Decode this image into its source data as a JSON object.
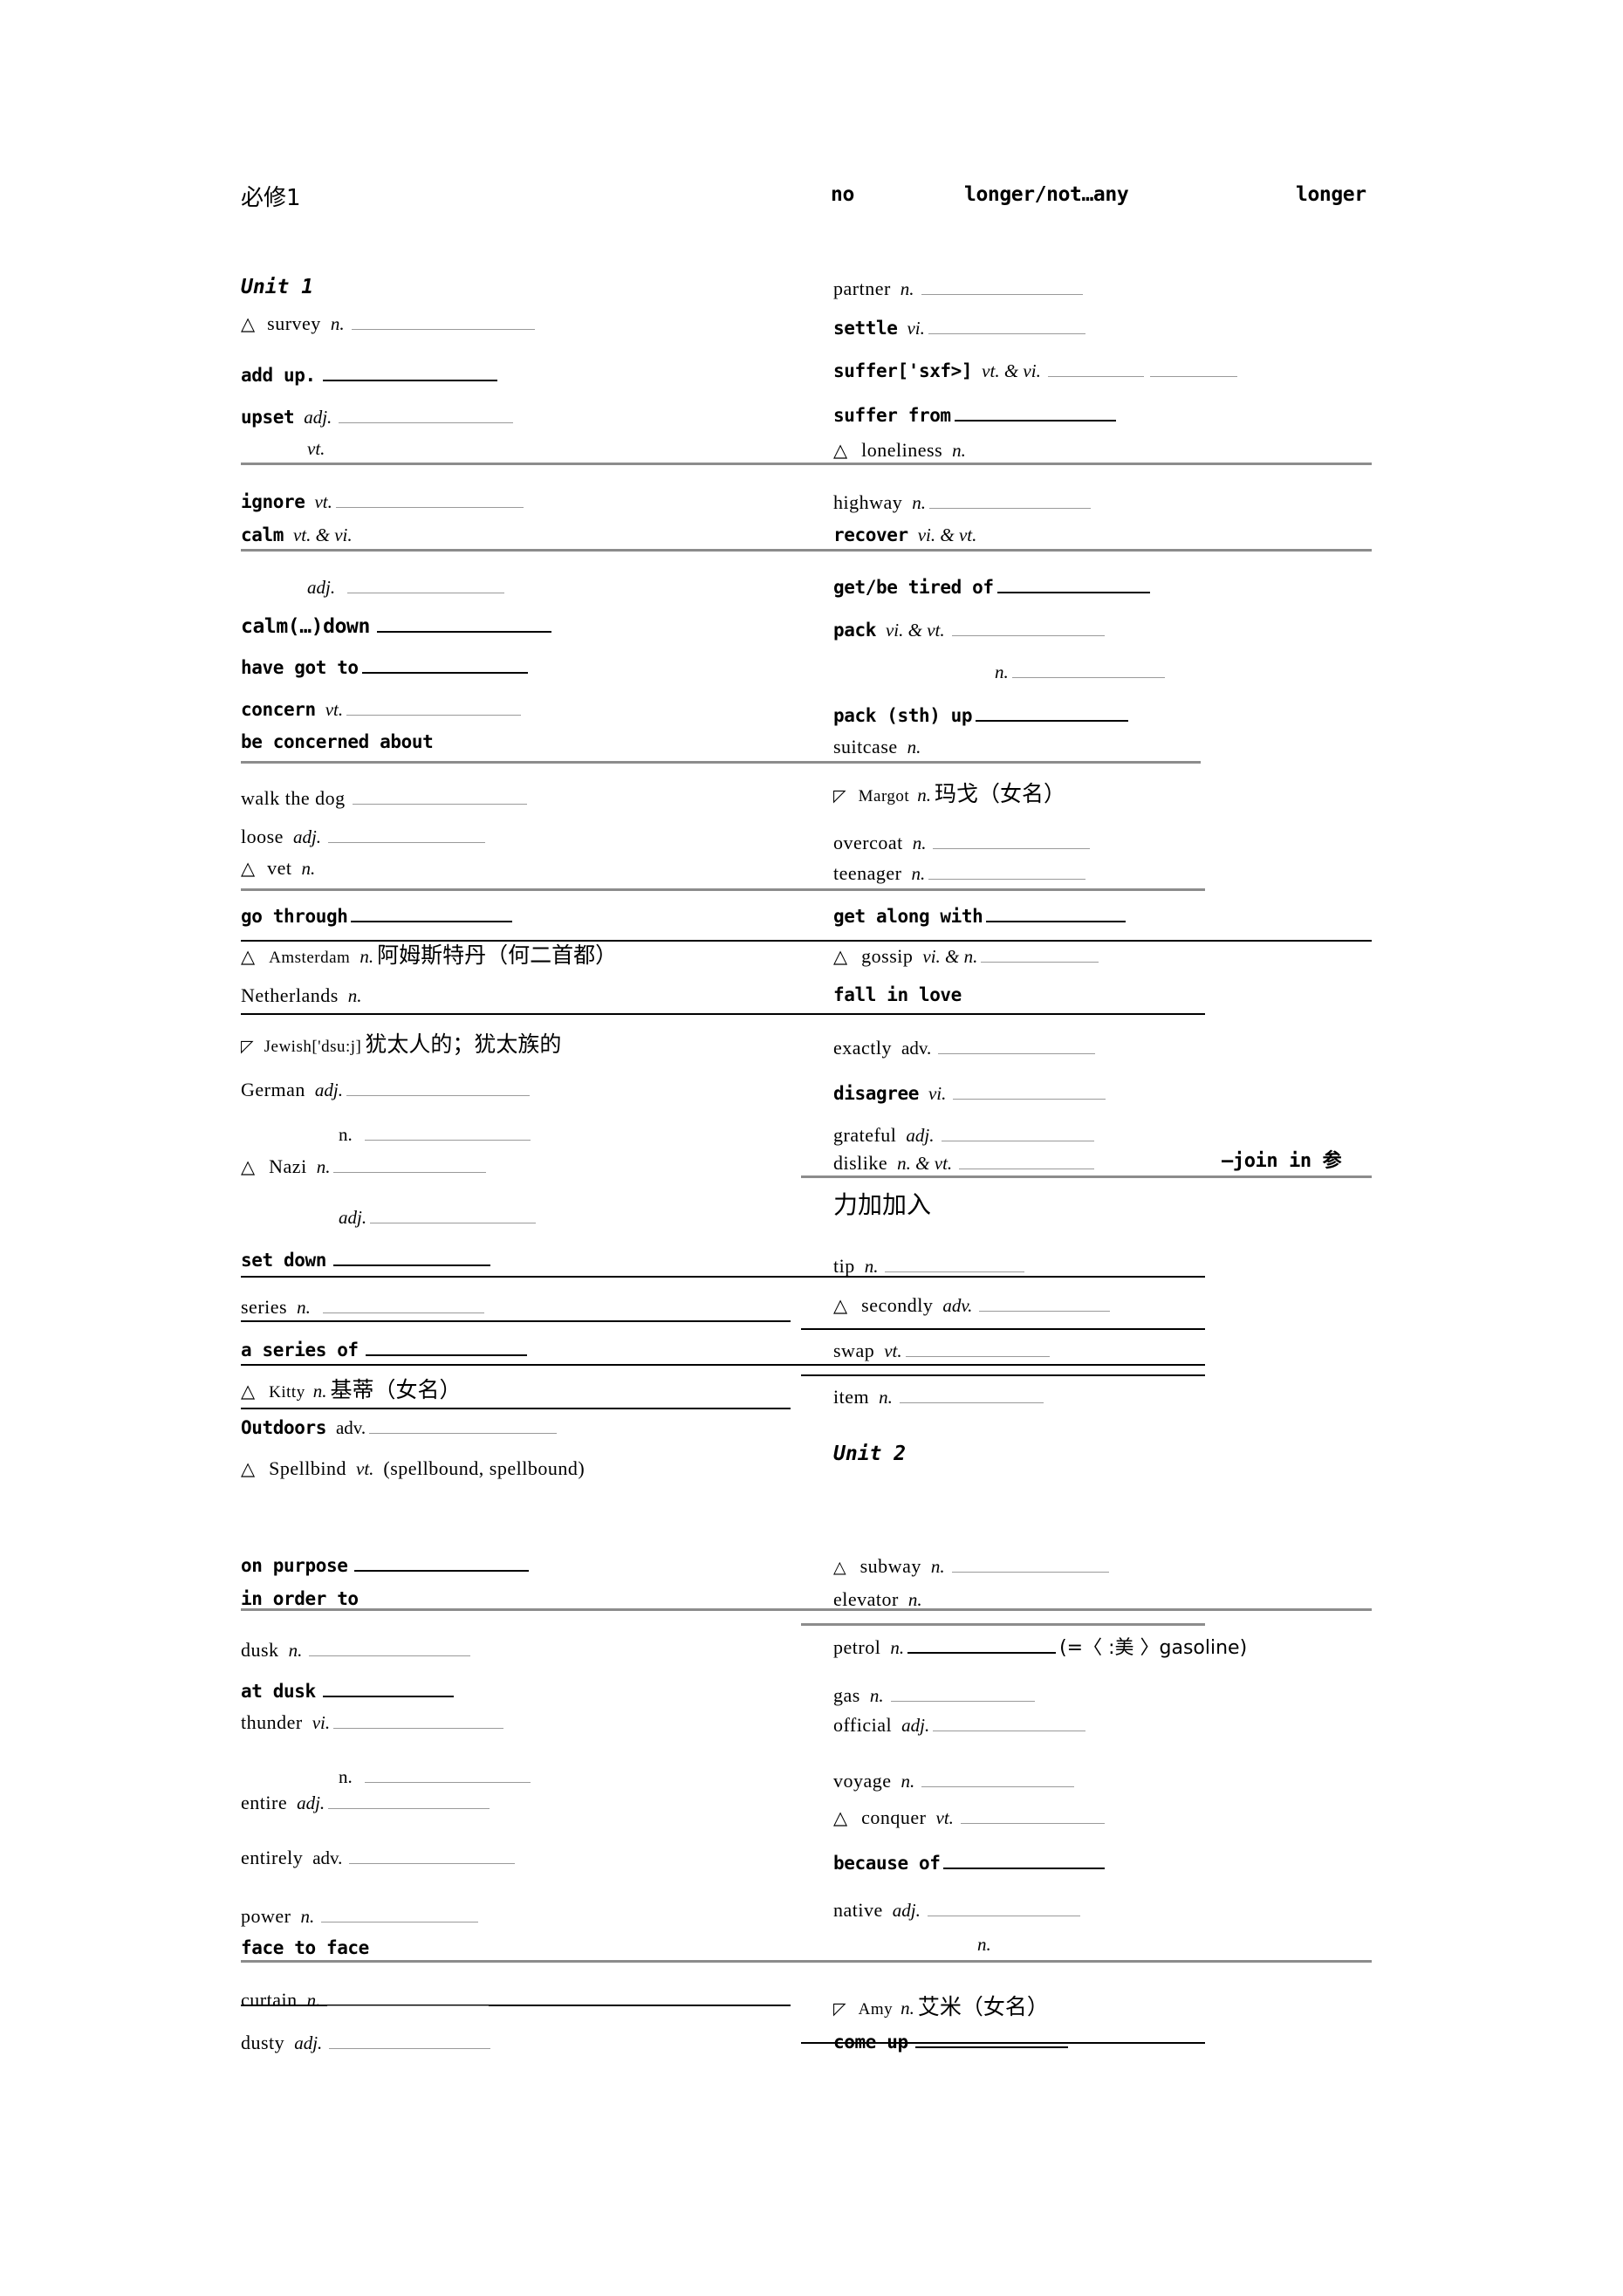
{
  "document": {
    "book_label": "必修1",
    "header_phrase_parts": [
      "no",
      "longer/not…any",
      "longer"
    ]
  },
  "units": {
    "unit1_label": "Unit 1",
    "unit2_label": "Unit 2"
  },
  "left_column": [
    {
      "tri": "△",
      "word": "survey",
      "bold": false,
      "pos": "n.",
      "note": ""
    },
    {
      "tri": "",
      "word": "add up.",
      "bold": true,
      "pos": "",
      "note": ""
    },
    {
      "tri": "",
      "word": "upset",
      "bold": true,
      "pos": "adj.",
      "note": ""
    },
    {
      "tri": "",
      "word": "",
      "bold": false,
      "pos": "vt.",
      "note": ""
    },
    {
      "tri": "",
      "word": "ignore",
      "bold": true,
      "pos": "vt.",
      "note": ""
    },
    {
      "tri": "",
      "word": "calm",
      "bold": true,
      "pos": "vt. & vi.",
      "note": ""
    },
    {
      "tri": "",
      "word": "",
      "bold": false,
      "pos": "adj.",
      "note": ""
    },
    {
      "tri": "",
      "word": "calm(…)down",
      "bold": true,
      "pos": "",
      "note": ""
    },
    {
      "tri": "",
      "word": "have got to",
      "bold": true,
      "pos": "",
      "note": ""
    },
    {
      "tri": "",
      "word": "concern",
      "bold": true,
      "pos": "vt.",
      "note": ""
    },
    {
      "tri": "",
      "word": "be concerned about",
      "bold": true,
      "pos": "",
      "note": ""
    },
    {
      "tri": "",
      "word": "walk the dog",
      "bold": false,
      "pos": "",
      "note": ""
    },
    {
      "tri": "",
      "word": "loose",
      "bold": false,
      "pos": "adj.",
      "note": ""
    },
    {
      "tri": "△",
      "word": "vet",
      "bold": false,
      "pos": "n.",
      "note": ""
    },
    {
      "tri": "",
      "word": "go through",
      "bold": true,
      "pos": "",
      "note": ""
    },
    {
      "tri": "△",
      "word": "Amsterdam",
      "bold": false,
      "pos": "n.",
      "note": "阿姆斯特丹（何二首都）"
    },
    {
      "tri": "",
      "word": "Netherlands",
      "bold": false,
      "pos": "n.",
      "note": ""
    },
    {
      "tri": "◸",
      "word": "Jewish['dsu:j]",
      "bold": false,
      "pos": "",
      "note": "犹太人的；犹太族的"
    },
    {
      "tri": "",
      "word": "German",
      "bold": false,
      "pos": "adj.",
      "note": ""
    },
    {
      "tri": "",
      "word": "",
      "bold": false,
      "pos": "n.",
      "note": ""
    },
    {
      "tri": "△",
      "word": "Nazi",
      "bold": false,
      "pos": "n.",
      "note": ""
    },
    {
      "tri": "",
      "word": "",
      "bold": false,
      "pos": "adj.",
      "note": ""
    },
    {
      "tri": "",
      "word": "set down",
      "bold": true,
      "pos": "",
      "note": ""
    },
    {
      "tri": "",
      "word": "series",
      "bold": false,
      "pos": "n.",
      "note": ""
    },
    {
      "tri": "",
      "word": "a series of",
      "bold": true,
      "pos": "",
      "note": ""
    },
    {
      "tri": "△",
      "word": "Kitty",
      "bold": false,
      "pos": "n.",
      "note": "基蒂（女名）"
    },
    {
      "tri": "",
      "word": "Outdoors",
      "bold": true,
      "pos": "adv.",
      "note": ""
    },
    {
      "tri": "△",
      "word": "Spellbind",
      "bold": false,
      "pos": "vt.",
      "note": "(spellbound, spellbound)"
    },
    {
      "tri": "",
      "word": "on purpose",
      "bold": true,
      "pos": "",
      "note": ""
    },
    {
      "tri": "",
      "word": "in order to",
      "bold": true,
      "pos": "",
      "note": ""
    },
    {
      "tri": "",
      "word": "dusk",
      "bold": false,
      "pos": "n.",
      "note": ""
    },
    {
      "tri": "",
      "word": "at dusk",
      "bold": true,
      "pos": "",
      "note": ""
    },
    {
      "tri": "",
      "word": "thunder",
      "bold": false,
      "pos": "vi.",
      "note": ""
    },
    {
      "tri": "",
      "word": "",
      "bold": false,
      "pos": "n.",
      "note": ""
    },
    {
      "tri": "",
      "word": "entire",
      "bold": false,
      "pos": "adj.",
      "note": ""
    },
    {
      "tri": "",
      "word": "entirely",
      "bold": false,
      "pos": "adv.",
      "note": ""
    },
    {
      "tri": "",
      "word": "power",
      "bold": false,
      "pos": "n.",
      "note": ""
    },
    {
      "tri": "",
      "word": "face to face",
      "bold": true,
      "pos": "",
      "note": ""
    },
    {
      "tri": "",
      "word": "curtain",
      "bold": false,
      "pos": "n.",
      "note": ""
    },
    {
      "tri": "",
      "word": "dusty",
      "bold": false,
      "pos": "adj.",
      "note": ""
    }
  ],
  "right_column": [
    {
      "tri": "",
      "word": "partner",
      "bold": false,
      "pos": "n.",
      "note": ""
    },
    {
      "tri": "",
      "word": "settle",
      "bold": true,
      "pos": "vi.",
      "note": ""
    },
    {
      "tri": "",
      "word": "suffer['sxf>]",
      "bold": true,
      "pos": "vt. & vi.",
      "note": ""
    },
    {
      "tri": "",
      "word": "suffer from",
      "bold": true,
      "pos": "",
      "note": ""
    },
    {
      "tri": "△",
      "word": "loneliness",
      "bold": false,
      "pos": "n.",
      "note": ""
    },
    {
      "tri": "",
      "word": "highway",
      "bold": false,
      "pos": "n.",
      "note": ""
    },
    {
      "tri": "",
      "word": "recover",
      "bold": true,
      "pos": "vi. & vt.",
      "note": ""
    },
    {
      "tri": "",
      "word": "get/be tired of",
      "bold": true,
      "pos": "",
      "note": ""
    },
    {
      "tri": "",
      "word": "pack",
      "bold": true,
      "pos": "vi. & vt.",
      "note": ""
    },
    {
      "tri": "",
      "word": "",
      "bold": false,
      "pos": "n.",
      "note": ""
    },
    {
      "tri": "",
      "word": "pack (sth) up",
      "bold": true,
      "pos": "",
      "note": ""
    },
    {
      "tri": "",
      "word": "suitcase",
      "bold": false,
      "pos": "n.",
      "note": ""
    },
    {
      "tri": "◸",
      "word": "Margot",
      "bold": false,
      "pos": "n.",
      "note": "玛戈（女名）"
    },
    {
      "tri": "",
      "word": "overcoat",
      "bold": false,
      "pos": "n.",
      "note": ""
    },
    {
      "tri": "",
      "word": "teenager",
      "bold": false,
      "pos": "n.",
      "note": ""
    },
    {
      "tri": "",
      "word": "get along with",
      "bold": true,
      "pos": "",
      "note": ""
    },
    {
      "tri": "△",
      "word": "gossip",
      "bold": false,
      "pos": "vi. & n.",
      "note": ""
    },
    {
      "tri": "",
      "word": "fall in love",
      "bold": true,
      "pos": "",
      "note": ""
    },
    {
      "tri": "",
      "word": "exactly",
      "bold": false,
      "pos": "adv.",
      "note": ""
    },
    {
      "tri": "",
      "word": "disagree",
      "bold": true,
      "pos": "vi.",
      "note": ""
    },
    {
      "tri": "",
      "word": "grateful",
      "bold": false,
      "pos": "adj.",
      "note": ""
    },
    {
      "tri": "",
      "word": "dislike",
      "bold": false,
      "pos": "n. & vt.",
      "note": ""
    },
    {
      "tri": "",
      "word": "tip",
      "bold": false,
      "pos": "n.",
      "note": ""
    },
    {
      "tri": "△",
      "word": "secondly",
      "bold": false,
      "pos": "adv.",
      "note": ""
    },
    {
      "tri": "",
      "word": "swap",
      "bold": false,
      "pos": "vt.",
      "note": ""
    },
    {
      "tri": "",
      "word": "item",
      "bold": false,
      "pos": "n.",
      "note": ""
    },
    {
      "tri": "△",
      "word": "subway",
      "bold": false,
      "pos": "n.",
      "note": ""
    },
    {
      "tri": "",
      "word": "elevator",
      "bold": false,
      "pos": "n.",
      "note": ""
    },
    {
      "tri": "",
      "word": "petrol",
      "bold": false,
      "pos": "n.",
      "note": "(=〈 :美 〉gasoline)"
    },
    {
      "tri": "",
      "word": "gas",
      "bold": false,
      "pos": "n.",
      "note": ""
    },
    {
      "tri": "",
      "word": "official",
      "bold": false,
      "pos": "adj.",
      "note": ""
    },
    {
      "tri": "",
      "word": "voyage",
      "bold": false,
      "pos": "n.",
      "note": ""
    },
    {
      "tri": "△",
      "word": "conquer",
      "bold": false,
      "pos": "vt.",
      "note": ""
    },
    {
      "tri": "",
      "word": "because of",
      "bold": true,
      "pos": "",
      "note": ""
    },
    {
      "tri": "",
      "word": "native",
      "bold": false,
      "pos": "adj.",
      "note": ""
    },
    {
      "tri": "",
      "word": "",
      "bold": false,
      "pos": "n.",
      "note": ""
    },
    {
      "tri": "◸",
      "word": "Amy",
      "bold": false,
      "pos": "n.",
      "note": "艾米（女名）"
    },
    {
      "tri": "",
      "word": "come up",
      "bold": true,
      "pos": "",
      "note": ""
    }
  ],
  "overflow": {
    "join_in_fragment": "—join in 参",
    "join_in_continuation": "力加加入"
  }
}
